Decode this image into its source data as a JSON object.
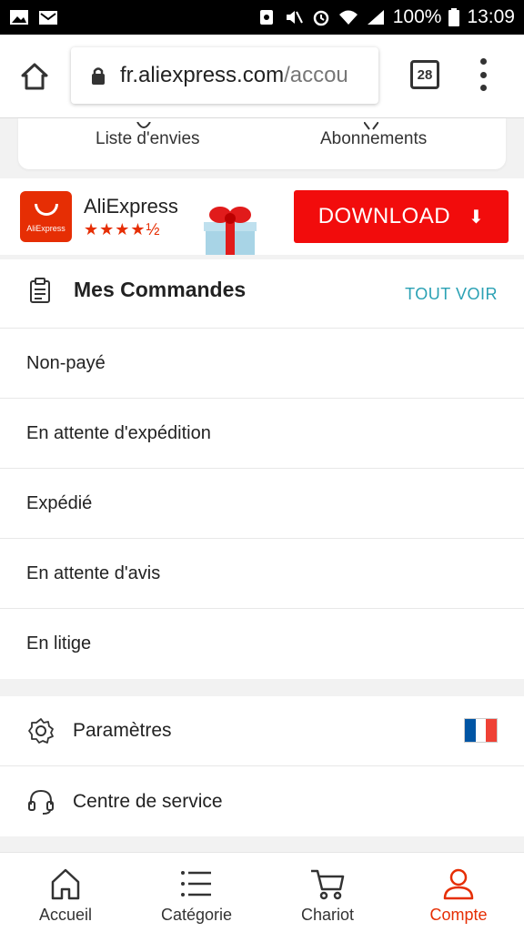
{
  "status_bar": {
    "battery": "100%",
    "time": "13:09"
  },
  "browser": {
    "url_main": "fr.aliexpress.com",
    "url_rest": "/accou",
    "tab_count": "28"
  },
  "top_card": {
    "wishlist_label": "Liste d'envies",
    "subscriptions_label": "Abonnements"
  },
  "app_banner": {
    "logo_text": "AliExpress",
    "app_name": "AliExpress",
    "rating_stars": "★★★★½",
    "download_label": "DOWNLOAD",
    "download_icon": "⬇"
  },
  "orders": {
    "title": "Mes Commandes",
    "see_all": "TOUT VOIR",
    "items": [
      {
        "label": "Non-payé"
      },
      {
        "label": "En attente d'expédition"
      },
      {
        "label": "Expédié"
      },
      {
        "label": "En attente d'avis"
      },
      {
        "label": "En litige"
      }
    ]
  },
  "settings": {
    "parametres_label": "Paramètres",
    "service_label": "Centre de service",
    "flag_colors": [
      "#0055a4",
      "#ffffff",
      "#ef4135"
    ]
  },
  "bottom_nav": {
    "items": [
      {
        "label": "Accueil",
        "icon": "home-icon"
      },
      {
        "label": "Catégorie",
        "icon": "category-icon"
      },
      {
        "label": "Chariot",
        "icon": "cart-icon"
      },
      {
        "label": "Compte",
        "icon": "account-icon"
      }
    ],
    "active_color": "#e62e04"
  }
}
